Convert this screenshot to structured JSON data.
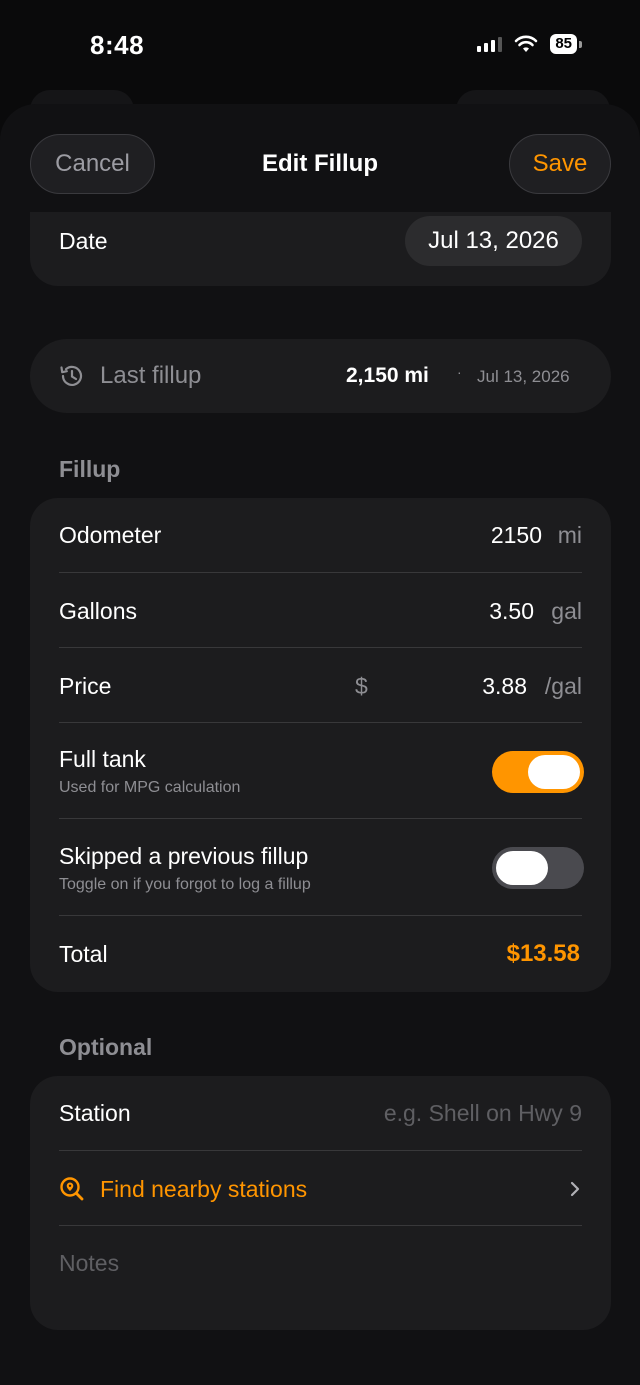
{
  "status": {
    "time": "8:48",
    "battery": "85"
  },
  "nav": {
    "cancel_label": "Cancel",
    "title": "Edit Fillup",
    "save_label": "Save"
  },
  "date": {
    "label": "Date",
    "value": "Jul 13, 2026"
  },
  "last_fillup": {
    "label": "Last fillup",
    "odometer": "2,150 mi",
    "separator": "·",
    "date": "Jul 13, 2026",
    "icon": "history-clock-icon"
  },
  "fillup": {
    "heading": "Fillup",
    "odometer": {
      "label": "Odometer",
      "value": "2150",
      "unit": "mi"
    },
    "gallons": {
      "label": "Gallons",
      "value": "3.50",
      "unit": "gal"
    },
    "price": {
      "label": "Price",
      "currency": "$",
      "value": "3.88",
      "unit": "/gal"
    },
    "full_tank": {
      "label": "Full tank",
      "sublabel": "Used for MPG calculation",
      "on": true
    },
    "skipped": {
      "label": "Skipped a previous fillup",
      "sublabel": "Toggle on if you forgot to log a fillup",
      "on": false
    },
    "total": {
      "label": "Total",
      "value": "$13.58"
    }
  },
  "optional": {
    "heading": "Optional",
    "station": {
      "label": "Station",
      "placeholder": "e.g. Shell on Hwy 9"
    },
    "find_nearby": {
      "label": "Find nearby stations",
      "icon": "search-location-icon"
    },
    "notes": {
      "placeholder": "Notes"
    }
  },
  "colors": {
    "accent": "#ff9500",
    "card": "#1c1c1e",
    "background": "#0a0a0b"
  }
}
